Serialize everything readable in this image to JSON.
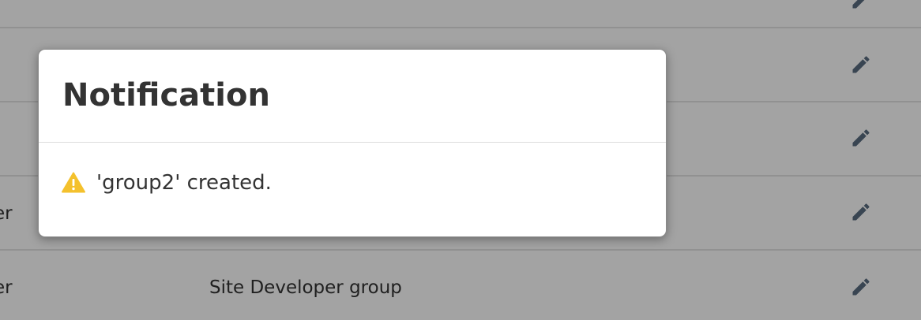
{
  "background_table": {
    "rows": [
      {
        "name": "",
        "description": "",
        "edit_icon": "pencil-icon"
      },
      {
        "name": "",
        "description": "",
        "edit_icon": "pencil-icon"
      },
      {
        "name": "",
        "description": "",
        "edit_icon": "pencil-icon"
      },
      {
        "name": "er",
        "description": "",
        "edit_icon": "pencil-icon"
      },
      {
        "name": "er",
        "description": "Site Developer group",
        "edit_icon": "pencil-icon"
      }
    ]
  },
  "modal": {
    "title": "Notification",
    "message": "'group2' created.",
    "icon": "warning-icon"
  },
  "colors": {
    "overlay": "rgba(0,0,0,0.36)",
    "warning": "#f4c12d",
    "pencil": "#5a6d80",
    "text": "#333333"
  }
}
